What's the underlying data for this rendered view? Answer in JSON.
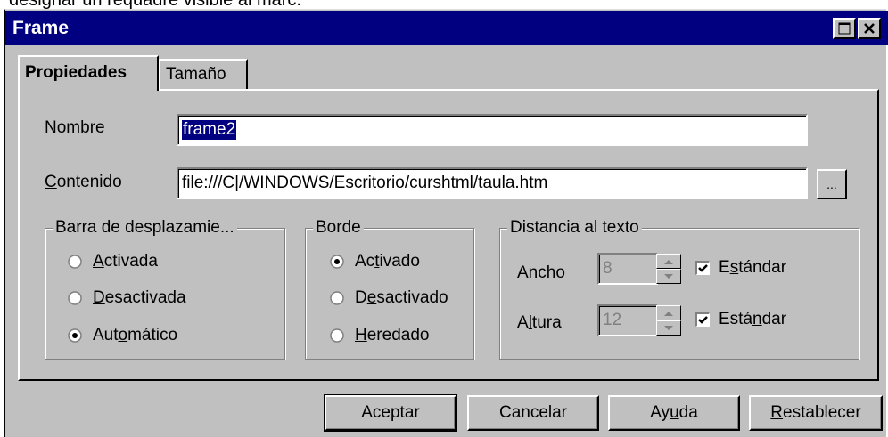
{
  "caption": "designar un requadre visible al marc.",
  "window": {
    "title": "Frame",
    "maximize_icon": "maximize-icon",
    "close_icon": "close-icon"
  },
  "tabs": [
    {
      "label": "Propiedades",
      "active": true
    },
    {
      "label": "Tamaño",
      "active": false
    }
  ],
  "fields": {
    "nombre": {
      "label_pre": "Nom",
      "label_u": "b",
      "label_post": "re",
      "value": "frame2"
    },
    "contenido": {
      "label_pre": "",
      "label_u": "C",
      "label_post": "ontenido",
      "value": "file:///C|/WINDOWS/Escritorio/curshtml/taula.htm",
      "browse": "..."
    }
  },
  "scroll_group": {
    "title": "Barra de desplazamie...",
    "options": [
      {
        "pre": "",
        "u": "A",
        "post": "ctivada",
        "checked": false
      },
      {
        "pre": "",
        "u": "D",
        "post": "esactivada",
        "checked": false
      },
      {
        "pre": "Aut",
        "u": "o",
        "post": "mático",
        "checked": true
      }
    ]
  },
  "border_group": {
    "title": "Borde",
    "options": [
      {
        "pre": "Ac",
        "u": "t",
        "post": "ivado",
        "checked": true
      },
      {
        "pre": "D",
        "u": "e",
        "post": "sactivado",
        "checked": false
      },
      {
        "pre": "",
        "u": "H",
        "post": "eredado",
        "checked": false
      }
    ]
  },
  "distance_group": {
    "title": "Distancia al texto",
    "ancho": {
      "pre": "Anch",
      "u": "o",
      "post": "",
      "value": "8",
      "check_pre": "E",
      "check_u": "s",
      "check_post": "tándar",
      "checked": true
    },
    "altura": {
      "pre": "A",
      "u": "l",
      "post": "tura",
      "value": "12",
      "check_pre": "Está",
      "check_u": "n",
      "check_post": "dar",
      "checked": true
    }
  },
  "buttons": {
    "accept": "Aceptar",
    "cancel": "Cancelar",
    "help_pre": "Ay",
    "help_u": "u",
    "help_post": "da",
    "reset_pre": "",
    "reset_u": "R",
    "reset_post": "establecer"
  },
  "colors": {
    "titlebar": "#000080",
    "face": "#c0c0c0",
    "selection": "#000080"
  }
}
